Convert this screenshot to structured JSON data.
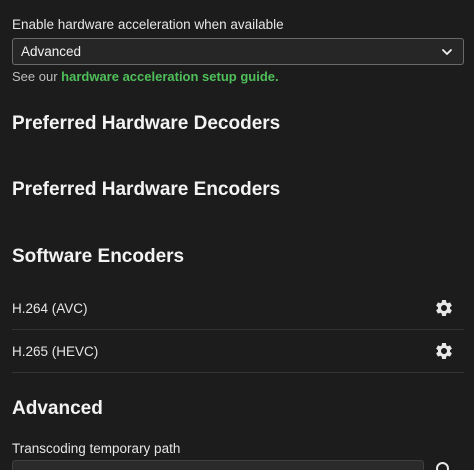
{
  "hw_accel": {
    "label": "Enable hardware acceleration when available",
    "selected": "Advanced",
    "help_prefix": "See our ",
    "help_link": "hardware acceleration setup guide."
  },
  "sections": {
    "decoders": "Preferred Hardware Decoders",
    "encoders": "Preferred Hardware Encoders",
    "software": "Software Encoders",
    "advanced": "Advanced"
  },
  "software_encoders": [
    {
      "name": "H.264 (AVC)",
      "icon": "gear-icon"
    },
    {
      "name": "H.265 (HEVC)",
      "icon": "gear-icon"
    }
  ],
  "advanced": {
    "temp_path_label": "Transcoding temporary path",
    "temp_path_value": ""
  }
}
